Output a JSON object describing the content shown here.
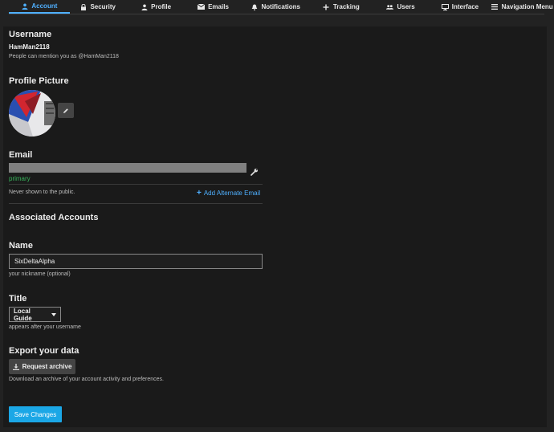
{
  "nav": {
    "tabs": [
      {
        "label": "Account",
        "icon": "user-icon",
        "active": true
      },
      {
        "label": "Security",
        "icon": "lock-icon"
      },
      {
        "label": "Profile",
        "icon": "user-icon"
      },
      {
        "label": "Emails",
        "icon": "envelope-icon"
      },
      {
        "label": "Notifications",
        "icon": "bell-icon"
      },
      {
        "label": "Tracking",
        "icon": "plus-icon"
      },
      {
        "label": "Users",
        "icon": "users-icon"
      },
      {
        "label": "Interface",
        "icon": "desktop-icon"
      },
      {
        "label": "Navigation Menu",
        "icon": "bars-icon"
      }
    ],
    "active_color": "#4fb0ff"
  },
  "username": {
    "heading": "Username",
    "value": "HamMan2118",
    "hint": "People can mention you as @HamMan2118"
  },
  "profile_picture": {
    "heading": "Profile Picture"
  },
  "email": {
    "heading": "Email",
    "primary_label": "primary",
    "hint": "Never shown to the public.",
    "add_label": "Add Alternate Email"
  },
  "associated_accounts": {
    "heading": "Associated Accounts"
  },
  "name": {
    "heading": "Name",
    "value": "SixDeltaAlpha",
    "hint": "your nickname (optional)"
  },
  "title": {
    "heading": "Title",
    "selected": "Local Guide",
    "hint": "appears after your username"
  },
  "export": {
    "heading": "Export your data",
    "button_label": "Request archive",
    "hint": "Download an archive of your account activity and preferences."
  },
  "save": {
    "label": "Save Changes",
    "color": "#1ba7e6"
  }
}
